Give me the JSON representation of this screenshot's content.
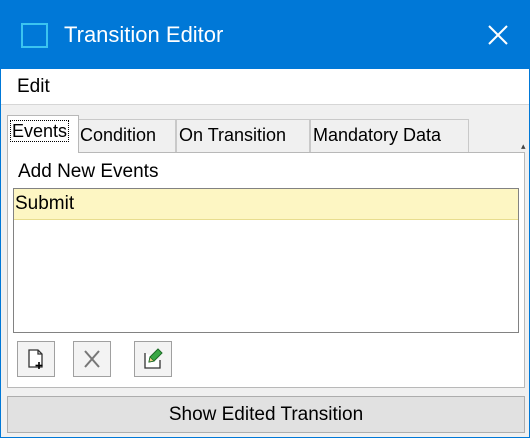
{
  "window": {
    "title": "Transition Editor"
  },
  "menu": {
    "items": [
      {
        "label": "Edit"
      }
    ]
  },
  "tabs": [
    {
      "label": "Events",
      "active": true
    },
    {
      "label": "Condition",
      "active": false
    },
    {
      "label": "On Transition",
      "active": false
    },
    {
      "label": "Mandatory Data",
      "active": false
    }
  ],
  "events_panel": {
    "label": "Add New Events",
    "items": [
      {
        "label": "Submit",
        "selected": true
      }
    ],
    "buttons": [
      {
        "name": "add-event-button",
        "icon": "new-document-icon"
      },
      {
        "name": "delete-event-button",
        "icon": "delete-x-icon"
      },
      {
        "name": "edit-event-button",
        "icon": "edit-pencil-icon"
      }
    ]
  },
  "footer": {
    "show_button_label": "Show Edited Transition"
  },
  "colors": {
    "titlebar": "#0078d7",
    "selected_item": "#fdf6c3",
    "title_icon_border": "#3bc4f0"
  }
}
